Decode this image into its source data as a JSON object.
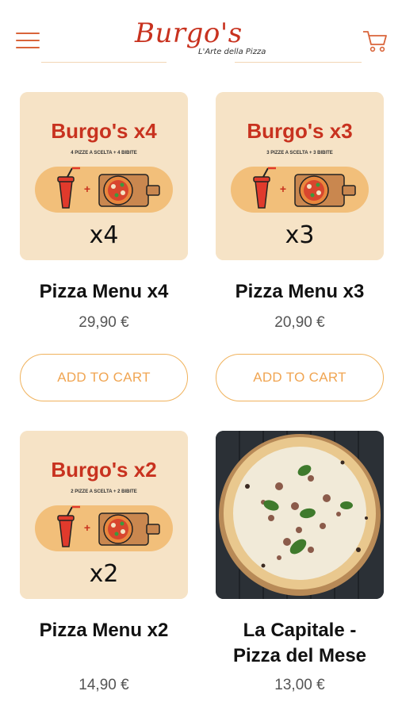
{
  "header": {
    "logo_name": "Burgo's",
    "logo_tagline": "L'Arte della Pizza",
    "menu_icon": "hamburger-menu-icon",
    "cart_icon": "shopping-cart-icon"
  },
  "products": [
    {
      "name": "Pizza Menu x4",
      "price": "29,90 €",
      "button": "ADD TO CART",
      "image": {
        "title": "Burgo's x4",
        "subtitle": "4 PIZZE A SCELTA + 4 BIBITE",
        "count": "x4"
      }
    },
    {
      "name": "Pizza Menu x3",
      "price": "20,90 €",
      "button": "ADD TO CART",
      "image": {
        "title": "Burgo's x3",
        "subtitle": "3 PIZZE A SCELTA + 3 BIBITE",
        "count": "x3"
      }
    },
    {
      "name": "Pizza Menu x2",
      "price": "14,90 €",
      "button": "",
      "image": {
        "title": "Burgo's x2",
        "subtitle": "2 PIZZE A SCELTA + 2 BIBITE",
        "count": "x2"
      }
    },
    {
      "name_line1": "La Capitale -",
      "name_line2": "Pizza del Mese",
      "price": "13,00 €"
    }
  ],
  "colors": {
    "brand_red": "#c8321f",
    "accent_orange": "#f0a552",
    "card_bg": "#f6e3c6"
  }
}
